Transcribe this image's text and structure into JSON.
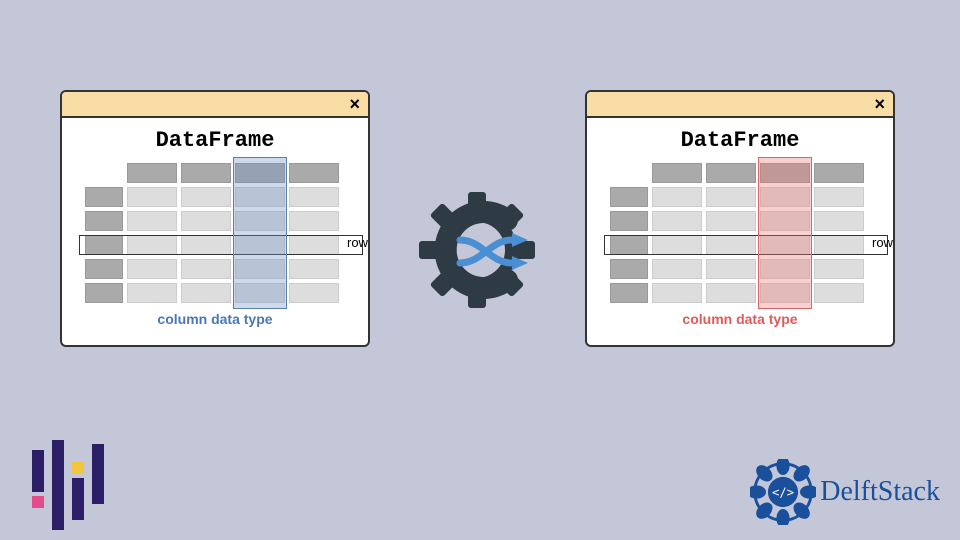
{
  "diagram": {
    "left_window": {
      "title": "DataFrame",
      "row_label": "row",
      "column_label": "column data type",
      "highlight_color": "blue"
    },
    "right_window": {
      "title": "DataFrame",
      "row_label": "row",
      "column_label": "column data type",
      "highlight_color": "red"
    },
    "close_symbol": "×"
  },
  "branding": {
    "site_name": "DelftStack"
  },
  "chart_data": {
    "type": "diagram",
    "description": "Two DataFrame window illustrations connected by a gear/convert icon with arrows, depicting conversion of a column's data type. Left DataFrame highlights a column in blue labeled 'column data type'; right DataFrame highlights the same column in red labeled 'column data type'. Both show a row outline labeled 'row'.",
    "left": {
      "entity": "DataFrame",
      "highlighted": "column",
      "color": "blue",
      "label": "column data type"
    },
    "right": {
      "entity": "DataFrame",
      "highlighted": "column",
      "color": "red",
      "label": "column data type"
    },
    "operation": "convert / transform (gear with shuffle arrows)"
  }
}
